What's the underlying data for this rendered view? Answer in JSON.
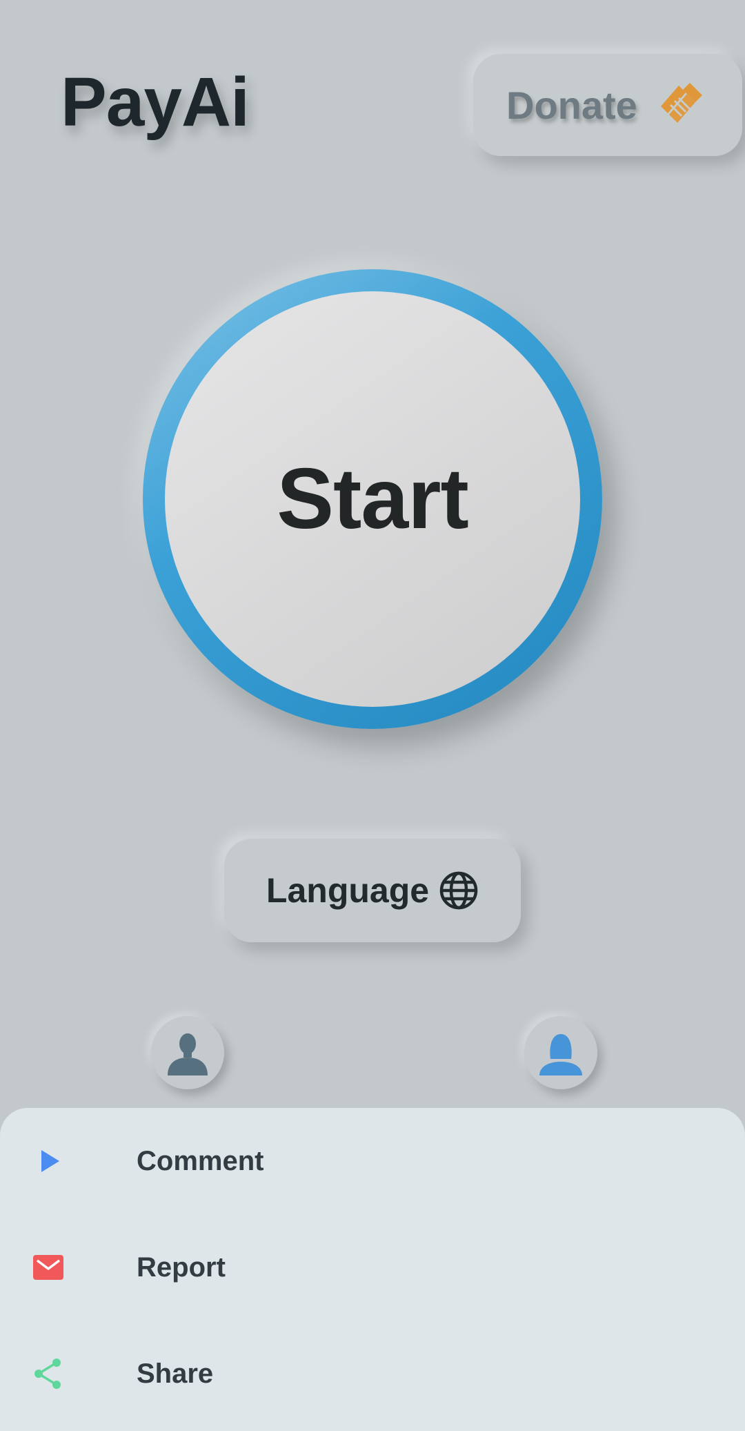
{
  "header": {
    "app_title": "PayAi",
    "donate_label": "Donate"
  },
  "main": {
    "start_label": "Start",
    "language_label": "Language"
  },
  "avatars": {
    "male_icon": "male-user-icon",
    "female_icon": "female-user-icon"
  },
  "menu": {
    "items": [
      {
        "label": "Comment",
        "icon": "play-icon",
        "color": "#4a8cf0"
      },
      {
        "label": "Report",
        "icon": "mail-icon",
        "color": "#f0585a"
      },
      {
        "label": "Share",
        "icon": "share-icon",
        "color": "#5fd79a"
      }
    ]
  },
  "colors": {
    "background": "#c2c8cb",
    "ring_accent": "#3aa0d6",
    "donate_icon": "#e0973a",
    "sheet_background": "#dfe6e9"
  }
}
